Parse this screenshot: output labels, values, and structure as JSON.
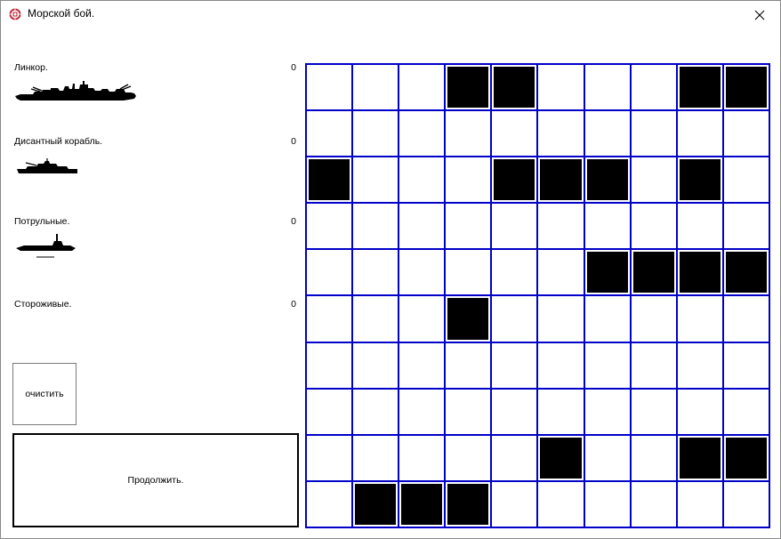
{
  "window": {
    "title": "Морской бой."
  },
  "ships": [
    {
      "label": "Линкор.",
      "count": "0",
      "icon": "battleship-icon"
    },
    {
      "label": "Дисантный корабль.",
      "count": "0",
      "icon": "landing-ship-icon"
    },
    {
      "label": "Потрульные.",
      "count": "0",
      "icon": "submarine-icon"
    },
    {
      "label": "Стороживые.",
      "count": "0",
      "icon": ""
    }
  ],
  "buttons": {
    "clear": "очистить",
    "continue": "Продолжить."
  },
  "board": {
    "rows": 10,
    "cols": 10,
    "filled_cells": [
      [
        0,
        3
      ],
      [
        0,
        4
      ],
      [
        0,
        8
      ],
      [
        0,
        9
      ],
      [
        2,
        0
      ],
      [
        2,
        4
      ],
      [
        2,
        5
      ],
      [
        2,
        6
      ],
      [
        2,
        8
      ],
      [
        4,
        6
      ],
      [
        4,
        7
      ],
      [
        4,
        8
      ],
      [
        4,
        9
      ],
      [
        5,
        3
      ],
      [
        8,
        5
      ],
      [
        8,
        8
      ],
      [
        8,
        9
      ],
      [
        9,
        1
      ],
      [
        9,
        2
      ],
      [
        9,
        3
      ]
    ]
  },
  "colors": {
    "grid_line": "#0000c8",
    "ship_fill": "#000000"
  }
}
